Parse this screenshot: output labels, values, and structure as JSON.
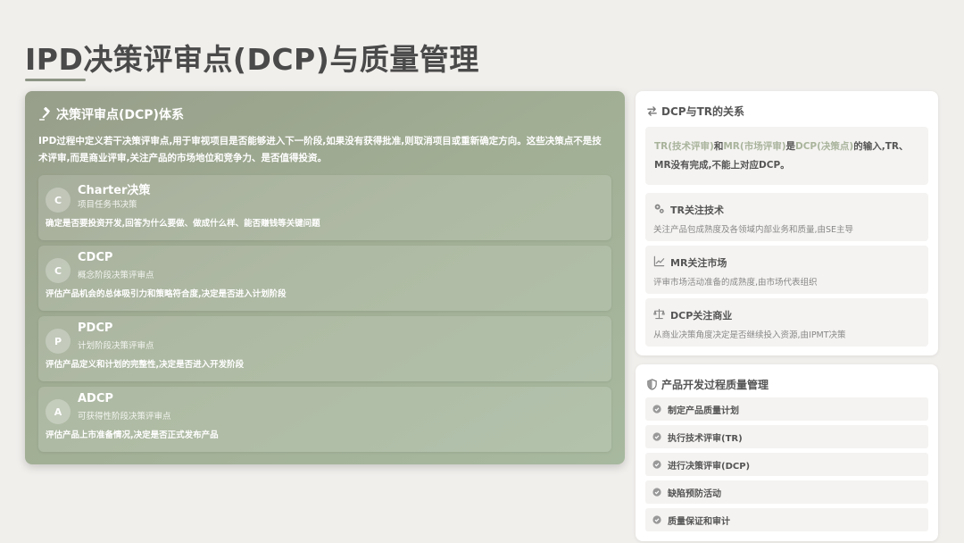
{
  "page": {
    "title": "IPD决策评审点(DCP)与质量管理"
  },
  "left": {
    "title": "决策评审点(DCP)体系",
    "title_icon": "gavel-icon",
    "description": "IPD过程中定义若干决策评审点,用于审视项目是否能够进入下一阶段,如果没有获得批准,则取消项目或重新确定方向。这些决策点不是技术评审,而是商业评审,关注产品的市场地位和竞争力、是否值得投资。",
    "cards": [
      {
        "badge": "C",
        "name": "Charter决策",
        "subtitle": "项目任务书决策",
        "desc": "确定是否要投资开发,回答为什么要做、做成什么样、能否赚钱等关键问题"
      },
      {
        "badge": "C",
        "name": "CDCP",
        "subtitle": "概念阶段决策评审点",
        "desc": "评估产品机会的总体吸引力和策略符合度,决定是否进入计划阶段"
      },
      {
        "badge": "P",
        "name": "PDCP",
        "subtitle": "计划阶段决策评审点",
        "desc": "评估产品定义和计划的完整性,决定是否进入开发阶段"
      },
      {
        "badge": "A",
        "name": "ADCP",
        "subtitle": "可获得性阶段决策评审点",
        "desc": "评估产品上市准备情况,决定是否正式发布产品"
      }
    ]
  },
  "relation": {
    "title": "DCP与TR的关系",
    "title_icon": "exchange-arrows-icon",
    "note": {
      "tr": "TR(技术评审)",
      "and": "和",
      "mr": "MR(市场评审)",
      "is": "是",
      "dcp": "DCP(决策点)",
      "rest": "的输入,TR、MR没有完成,不能上对应DCP。"
    },
    "items": [
      {
        "icon": "gears-icon",
        "title": "TR关注技术",
        "desc": "关注产品包成熟度及各领域内部业务和质量,由SE主导"
      },
      {
        "icon": "chart-line-icon",
        "title": "MR关注市场",
        "desc": "评审市场活动准备的成熟度,由市场代表组织"
      },
      {
        "icon": "scale-icon",
        "title": "DCP关注商业",
        "desc": "从商业决策角度决定是否继续投入资源,由IPMT决策"
      }
    ]
  },
  "quality": {
    "title": "产品开发过程质量管理",
    "title_icon": "shield-icon",
    "items": [
      {
        "label": "制定产品质量计划"
      },
      {
        "label": "执行技术评审(TR)"
      },
      {
        "label": "进行决策评审(DCP)"
      },
      {
        "label": "缺陷预防活动"
      },
      {
        "label": "质量保证和审计"
      }
    ]
  },
  "colors": {
    "accent": "#a1ae94",
    "highlight": "#a9b49c",
    "background": "#f1efec"
  }
}
